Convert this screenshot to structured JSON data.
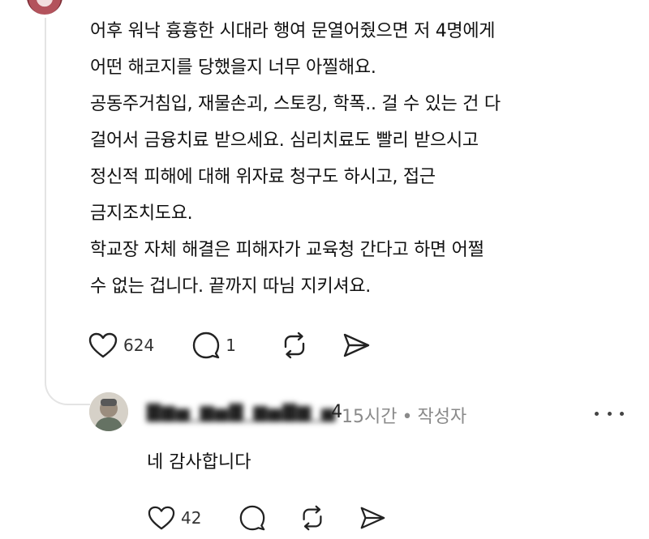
{
  "comment": {
    "lines": [
      "어후 워낙 흉흉한 시대라 행여 문열어줬으면 저 4명에게",
      "어떤 해코지를 당했을지 너무 아찔해요.",
      "공동주거침입, 재물손괴, 스토킹, 학폭.. 걸 수 있는 건 다",
      "걸어서 금융치료 받으세요. 심리치료도 빨리 받으시고",
      "정신적 피해에 대해 위자료 청구도 하시고, 접근",
      "금지조치도요.",
      "학교장 자체 해결은 피해자가 교육청 간다고 하면 어쩔",
      "수 없는 겁니다. 끝까지 따님 지키셔요."
    ],
    "actions": {
      "like_count": "624",
      "reply_count": "1"
    }
  },
  "reply": {
    "username_tail": "4",
    "time": "15시간",
    "separator": "•",
    "author_badge": "작성자",
    "text": "네 감사합니다",
    "actions": {
      "like_count": "42"
    }
  },
  "icons": {
    "like": "heart-icon",
    "reply": "comment-bubble-icon",
    "repost": "repost-icon",
    "share": "send-icon",
    "more": "more-dots-icon"
  }
}
